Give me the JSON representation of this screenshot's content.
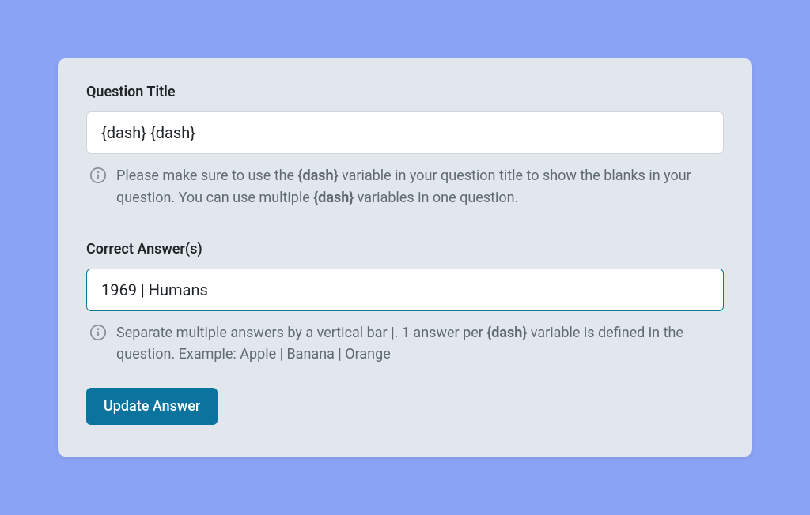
{
  "questionTitle": {
    "label": "Question Title",
    "value": "{dash} {dash}",
    "helper_pre": "Please make sure to use the ",
    "helper_bold1": "{dash}",
    "helper_mid": " variable in your question title to show the blanks in your question. You can use multiple ",
    "helper_bold2": "{dash}",
    "helper_post": " variables in one question."
  },
  "correctAnswers": {
    "label": "Correct Answer(s)",
    "value": "1969 | Humans",
    "helper_pre": "Separate multiple answers by a vertical bar ",
    "helper_bold1": "|",
    "helper_mid": ". 1 answer per ",
    "helper_bold2": "{dash}",
    "helper_post": " variable is defined in the question. Example: Apple | Banana | Orange"
  },
  "button": {
    "label": "Update Answer"
  }
}
